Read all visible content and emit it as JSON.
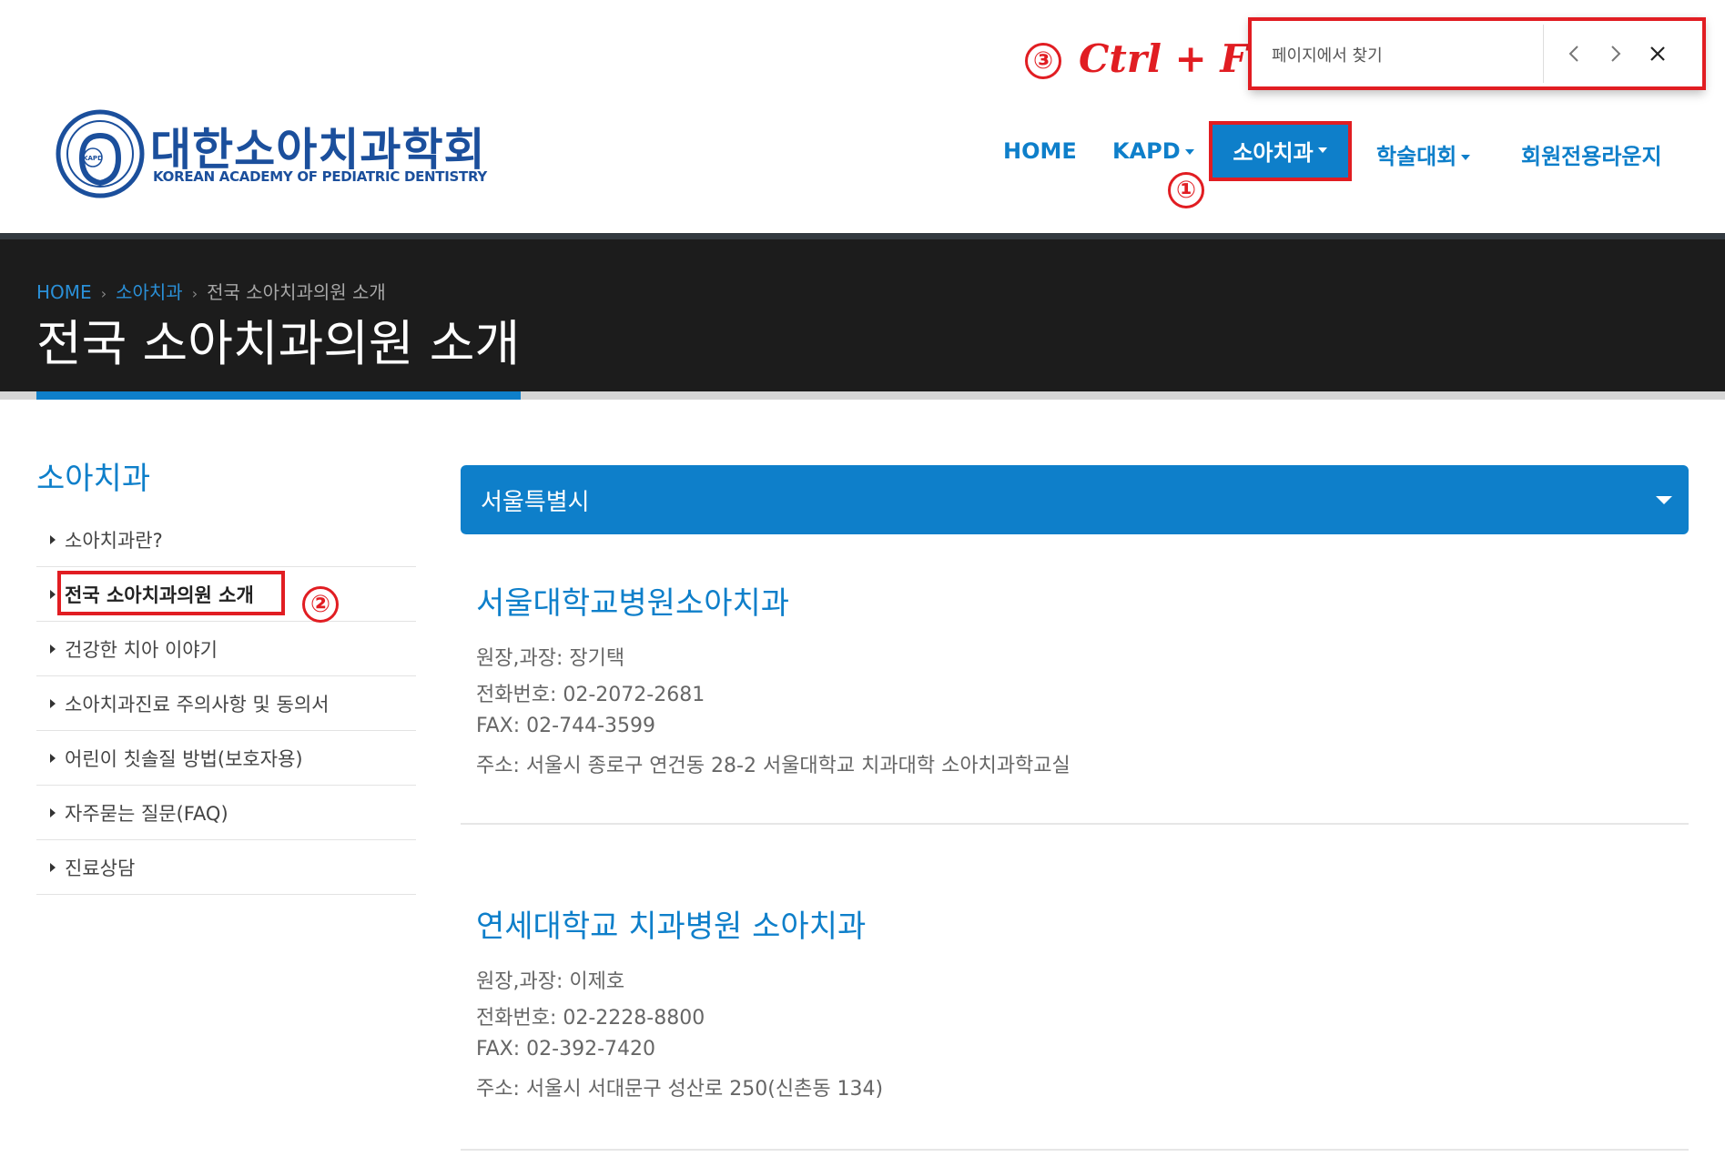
{
  "brand": {
    "name_ko": "대한소아치과학회",
    "name_en": "KOREAN ACADEMY OF PEDIATRIC DENTISTRY",
    "logo_badge": "KAPD",
    "logo_color": "#1b4f9c"
  },
  "nav": {
    "items": [
      "HOME",
      "KAPD",
      "소아치과",
      "학술대회",
      "회원전용라운지"
    ],
    "active": "소아치과",
    "color": "#0e7fca"
  },
  "find_bar": {
    "placeholder": "페이지에서 찾기",
    "prev_icon": "chevron-left-icon",
    "next_icon": "chevron-right-icon",
    "close_icon": "close-icon"
  },
  "annotations": {
    "step1": "①",
    "step2": "②",
    "step3": "③",
    "shortcut": "Ctrl + F",
    "color": "#e11d22"
  },
  "breadcrumb": [
    "HOME",
    "소아치과",
    "전국 소아치과의원 소개"
  ],
  "page_title": "전국 소아치과의원 소개",
  "sidebar": {
    "title": "소아치과",
    "items": [
      "소아치과란?",
      "전국 소아치과의원 소개",
      "건강한 치아 이야기",
      "소아치과진료 주의사항 및 동의서",
      "어린이 칫솔질 방법(보호자용)",
      "자주묻는 질문(FAQ)",
      "진료상담"
    ],
    "active_index": 1
  },
  "region": "서울특별시",
  "clinics": [
    {
      "name": "서울대학교병원소아치과",
      "director": "원장,과장: 장기택",
      "phone": "전화번호: 02-2072-2681",
      "fax": "FAX: 02-744-3599",
      "address": "주소: 서울시 종로구 연건동 28-2 서울대학교 치과대학 소아치과학교실"
    },
    {
      "name": "연세대학교 치과병원 소아치과",
      "director": "원장,과장: 이제호",
      "phone": "전화번호: 02-2228-8800",
      "fax": "FAX: 02-392-7420",
      "address": "주소: 서울시 서대문구 성산로 250(신촌동 134)"
    }
  ]
}
